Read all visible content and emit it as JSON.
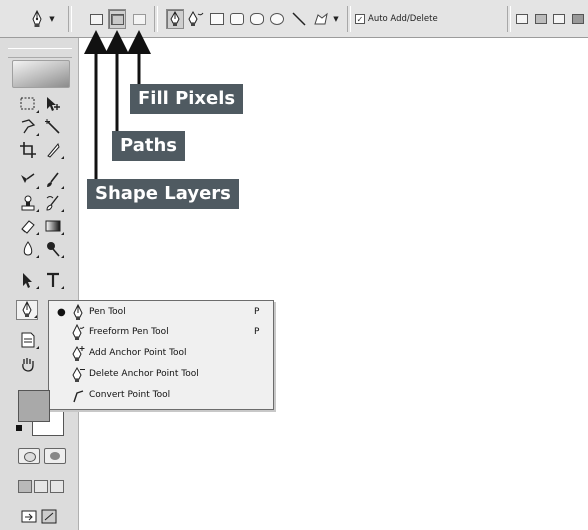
{
  "options_bar": {
    "auto_add_delete_label": "Auto Add/Delete",
    "auto_add_delete_checked": true
  },
  "callouts": [
    {
      "id": "fill-pixels",
      "label": "Fill Pixels"
    },
    {
      "id": "paths",
      "label": "Paths"
    },
    {
      "id": "shape-layers",
      "label": "Shape Layers"
    }
  ],
  "tools_panel": {
    "foreground_color": "#a9a9a9",
    "background_color": "#ffffff"
  },
  "flyout": {
    "items": [
      {
        "label": "Pen Tool",
        "shortcut": "P",
        "selected": true,
        "icon": "pen-icon"
      },
      {
        "label": "Freeform Pen Tool",
        "shortcut": "P",
        "selected": false,
        "icon": "freeform-pen-icon"
      },
      {
        "label": "Add Anchor Point Tool",
        "shortcut": "",
        "selected": false,
        "icon": "add-anchor-icon"
      },
      {
        "label": "Delete Anchor Point Tool",
        "shortcut": "",
        "selected": false,
        "icon": "delete-anchor-icon"
      },
      {
        "label": "Convert Point Tool",
        "shortcut": "",
        "selected": false,
        "icon": "convert-point-icon"
      }
    ]
  },
  "colors": {
    "callout_bg": "#4f5a61",
    "callout_text": "#ffffff",
    "panel_bg": "#dcdcdc"
  }
}
